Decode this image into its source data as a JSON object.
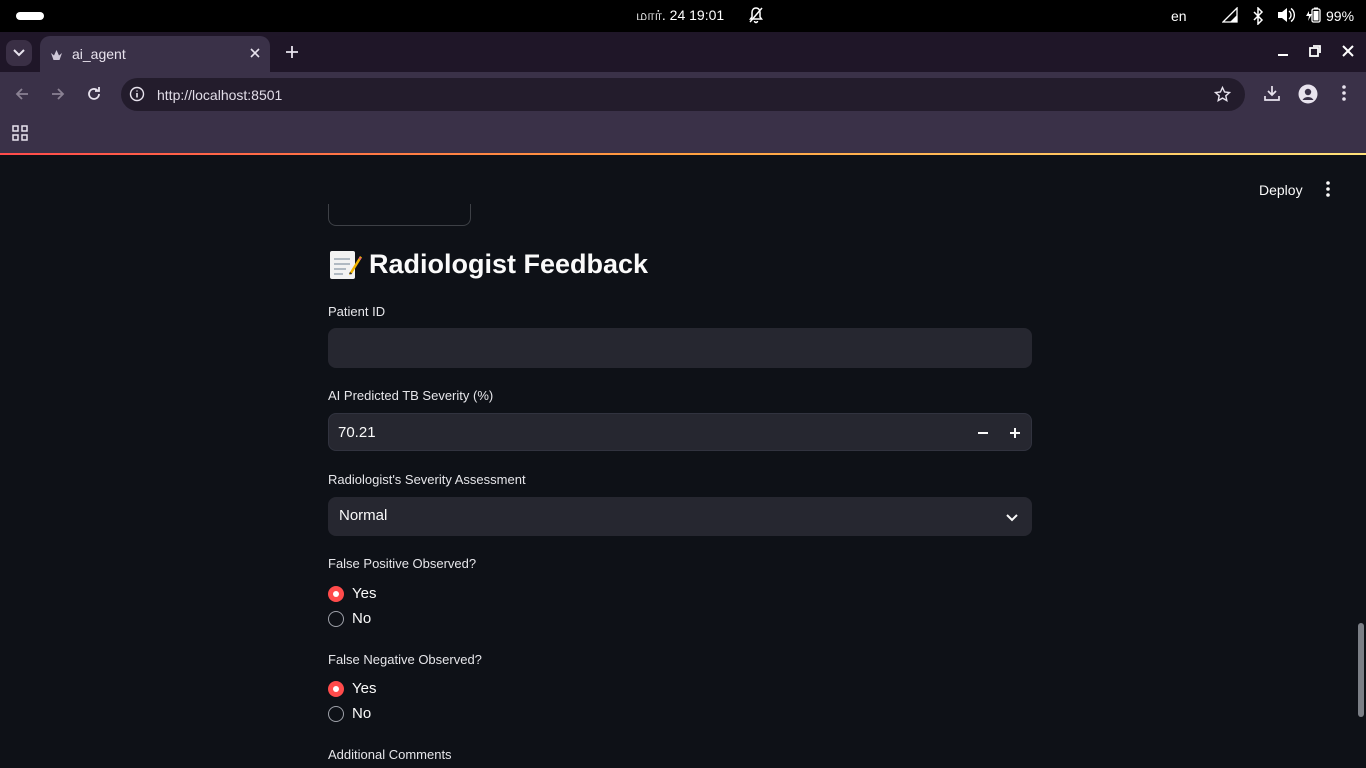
{
  "os": {
    "clock": "மார். 24  19:01",
    "lang": "en",
    "battery": "99%"
  },
  "browser": {
    "tab_title": "ai_agent",
    "url": "http://localhost:8501"
  },
  "app": {
    "deploy_label": "Deploy",
    "heading": "Radiologist Feedback",
    "patient_id": {
      "label": "Patient ID",
      "value": ""
    },
    "severity": {
      "label": "AI Predicted TB Severity (%)",
      "value": "70.21"
    },
    "assessment": {
      "label": "Radiologist's Severity Assessment",
      "selected": "Normal"
    },
    "false_positive": {
      "label": "False Positive Observed?",
      "options": [
        "Yes",
        "No"
      ],
      "selected": "Yes"
    },
    "false_negative": {
      "label": "False Negative Observed?",
      "options": [
        "Yes",
        "No"
      ],
      "selected": "Yes"
    },
    "comments": {
      "label": "Additional Comments"
    }
  },
  "colors": {
    "accent": "#ff4b4b",
    "background": "#0e1117",
    "input_bg": "#262730"
  }
}
